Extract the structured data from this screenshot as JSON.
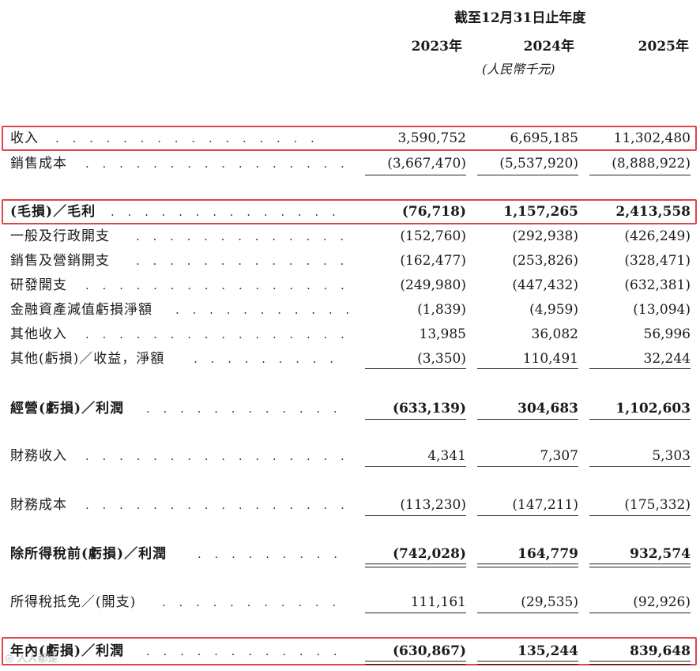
{
  "header": {
    "period": "截至12月31日止年度",
    "years": [
      "2023年",
      "2024年",
      "2025年"
    ],
    "unit": "(人民幣千元)"
  },
  "rows": [
    {
      "label": "收入",
      "v": [
        "3,590,752",
        "6,695,185",
        "11,302,480"
      ]
    },
    {
      "label": "銷售成本",
      "v": [
        "(3,667,470)",
        "(5,537,920)",
        "(8,888,922)"
      ]
    },
    {
      "label": "(毛損)／毛利",
      "v": [
        "(76,718)",
        "1,157,265",
        "2,413,558"
      ]
    },
    {
      "label": "一般及行政開支",
      "v": [
        "(152,760)",
        "(292,938)",
        "(426,249)"
      ]
    },
    {
      "label": "銷售及營銷開支",
      "v": [
        "(162,477)",
        "(253,826)",
        "(328,471)"
      ]
    },
    {
      "label": "研發開支",
      "v": [
        "(249,980)",
        "(447,432)",
        "(632,381)"
      ]
    },
    {
      "label": "金融資產減值虧損淨額",
      "v": [
        "(1,839)",
        "(4,959)",
        "(13,094)"
      ]
    },
    {
      "label": "其他收入",
      "v": [
        "13,985",
        "36,082",
        "56,996"
      ]
    },
    {
      "label": "其他(虧損)／收益，淨額",
      "v": [
        "(3,350)",
        "110,491",
        "32,244"
      ]
    },
    {
      "label": "經營(虧損)／利潤",
      "v": [
        "(633,139)",
        "304,683",
        "1,102,603"
      ]
    },
    {
      "label": "財務收入",
      "v": [
        "4,341",
        "7,307",
        "5,303"
      ]
    },
    {
      "label": "財務成本",
      "v": [
        "(113,230)",
        "(147,211)",
        "(175,332)"
      ]
    },
    {
      "label": "除所得稅前(虧損)／利潤",
      "v": [
        "(742,028)",
        "164,779",
        "932,574"
      ]
    },
    {
      "label": "所得稅抵免／(開支)",
      "v": [
        "111,161",
        "(29,535)",
        "(92,926)"
      ]
    },
    {
      "label": "年內(虧損)／利潤",
      "v": [
        "(630,867)",
        "135,244",
        "839,648"
      ]
    }
  ],
  "leader_dots": ". . . . . . . . . . . . . . . . . . . . . . . . . . . . . . . . . . . . .",
  "watermark": "◎ 人人都是",
  "highlight_color": "#e0454a"
}
